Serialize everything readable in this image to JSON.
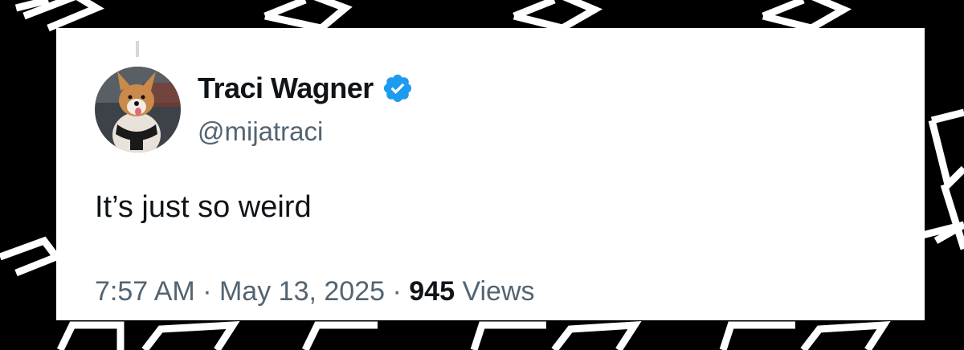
{
  "tweet": {
    "display_name": "Traci Wagner",
    "handle": "@mijatraci",
    "text": "It’s just so weird",
    "time": "7:57 AM",
    "separator": "·",
    "date": "May 13, 2025",
    "views_count": "945",
    "views_label": "Views",
    "verified": true,
    "avatar_icon": "dog-avatar"
  },
  "colors": {
    "background": "#000000",
    "card": "#ffffff",
    "text_primary": "#0f1419",
    "text_secondary": "#536471",
    "verified_badge": "#1d9bf0"
  }
}
